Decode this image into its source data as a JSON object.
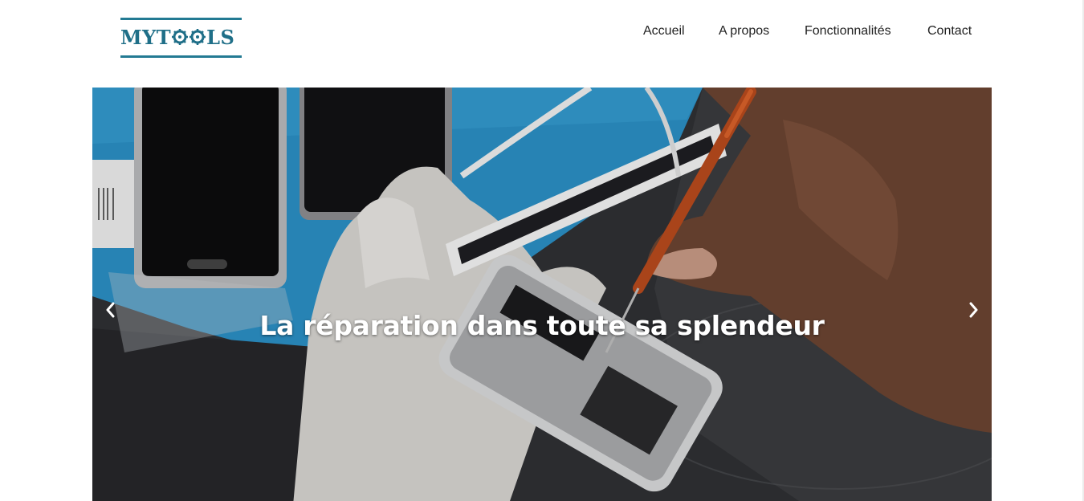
{
  "brand": {
    "logo_text": "MYTOOLS",
    "logo_prefix": "MYT",
    "logo_suffix": "LS",
    "logo_color": "#1f6f88"
  },
  "nav": {
    "items": [
      {
        "label": "Accueil"
      },
      {
        "label": "A propos"
      },
      {
        "label": "Fonctionnalités"
      },
      {
        "label": "Contact"
      }
    ]
  },
  "hero": {
    "caption": "La réparation dans toute sa splendeur",
    "prev_icon": "chevron-left-icon",
    "next_icon": "chevron-right-icon"
  },
  "colors": {
    "accent": "#237a93",
    "text": "#222222",
    "caption": "#ffffff"
  }
}
